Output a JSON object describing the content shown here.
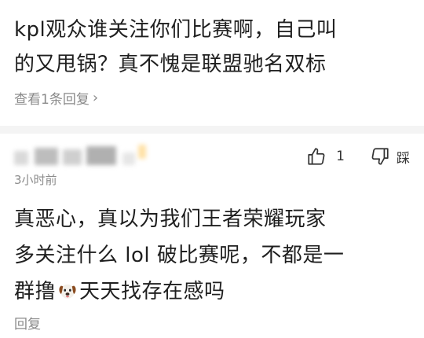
{
  "comment_top": {
    "text": "kpl观众谁关注你们比赛啊，自己叫\n的又甩锅？真不愧是联盟驰名双标",
    "view_replies_label": "查看1条回复"
  },
  "comment_second": {
    "time": "3小时前",
    "like_count": "1",
    "dislike_label": "踩",
    "text_part1": "真恶心，真以为我们王者荣耀玩家\n多关注什么 lol 破比赛呢，不都是一\n群撸",
    "text_part2": "天天找存在感吗",
    "reply_label": "回复"
  },
  "icons": {
    "like": "thumbs-up-icon",
    "dislike": "thumbs-down-icon",
    "chevron": "chevron-right-icon",
    "emoji": "dog-face-emoji-icon"
  },
  "colors": {
    "text_primary": "#1f1f1f",
    "text_secondary": "#8a8a8a",
    "divider": "#f4f4f4"
  }
}
